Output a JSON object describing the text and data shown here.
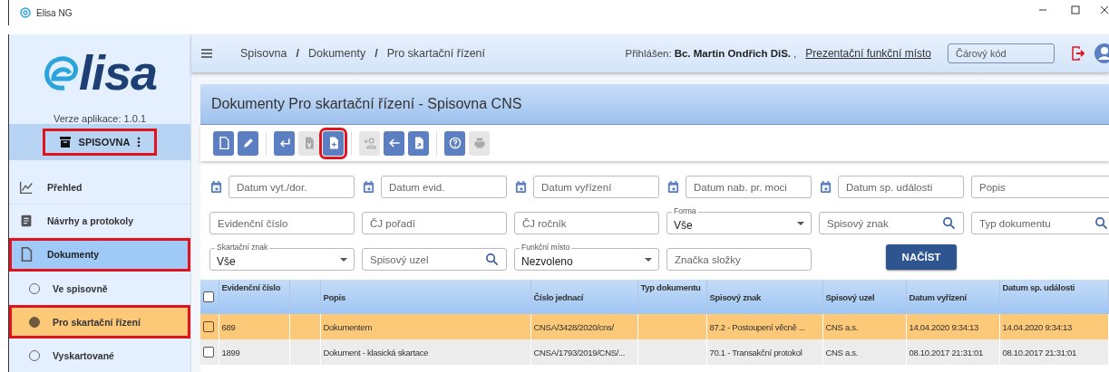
{
  "window": {
    "title": "Elisa NG"
  },
  "sidebar": {
    "logo": "lisa",
    "version": "Verze aplikace: 1.0.1",
    "section": {
      "label": "SPISOVNA",
      "highlighted": true
    },
    "items": [
      {
        "label": "Přehled",
        "selected": false,
        "highlighted": false
      },
      {
        "label": "Návrhy a protokoly",
        "selected": false,
        "highlighted": false
      },
      {
        "label": "Dokumenty",
        "selected": true,
        "highlighted": true,
        "children": [
          {
            "label": "Ve spisovně",
            "selected": false,
            "highlighted": false
          },
          {
            "label": "Pro skartační řízení",
            "selected": true,
            "highlighted": true
          },
          {
            "label": "Vyskartované",
            "selected": false,
            "highlighted": false
          }
        ]
      }
    ]
  },
  "header": {
    "breadcrumbs": [
      {
        "kind": "crumb",
        "label": "Spisovna"
      },
      {
        "kind": "separator",
        "label": "/"
      },
      {
        "kind": "crumb",
        "label": "Dokumenty"
      },
      {
        "kind": "separator",
        "label": "/"
      },
      {
        "kind": "crumb",
        "label": "Pro skartační řízení"
      }
    ],
    "login_label": "Přihlášen:",
    "user": "Bc. Martin Ondřich DiS.",
    "separator": ",",
    "workplace": "Prezentační funkční místo",
    "barcode": {
      "placeholder": "Čárový kód"
    }
  },
  "panel": {
    "title": "Dokumenty Pro skartační řízení - Spisovna CNS",
    "toolbar": [
      [
        {
          "disabled": false,
          "highlighted": false
        },
        {
          "disabled": false,
          "highlighted": false
        }
      ],
      [
        {
          "disabled": false,
          "highlighted": false
        },
        {
          "disabled": true,
          "highlighted": false
        },
        {
          "disabled": false,
          "highlighted": true
        }
      ],
      [
        {
          "disabled": true,
          "highlighted": false
        },
        {
          "disabled": false,
          "highlighted": false
        },
        {
          "disabled": false,
          "highlighted": false
        }
      ],
      [
        {
          "disabled": false,
          "highlighted": false
        },
        {
          "disabled": true,
          "highlighted": false
        }
      ]
    ],
    "filters": [
      [
        {
          "kind": "date",
          "placeholder": "Datum vyt./dor."
        },
        {
          "kind": "date",
          "placeholder": "Datum evid."
        },
        {
          "kind": "date",
          "placeholder": "Datum vyřízení"
        },
        {
          "kind": "date",
          "placeholder": "Datum nab. pr. moci"
        },
        {
          "kind": "date",
          "placeholder": "Datum sp. události"
        },
        {
          "kind": "text",
          "placeholder": "Popis"
        }
      ],
      [
        {
          "kind": "text",
          "placeholder": "Evidenční číslo"
        },
        {
          "kind": "text",
          "placeholder": "ČJ pořadí"
        },
        {
          "kind": "text",
          "placeholder": "ČJ ročník"
        },
        {
          "kind": "select",
          "label": "Forma",
          "value": "Vše"
        },
        {
          "kind": "search",
          "placeholder": "Spisový znak"
        },
        {
          "kind": "search",
          "placeholder": "Typ dokumentu"
        }
      ],
      [
        {
          "kind": "select",
          "label": "Skartační znak",
          "value": "Vše"
        },
        {
          "kind": "search",
          "placeholder": "Spisový uzel"
        },
        {
          "kind": "select",
          "label": "Funkční místo",
          "value": "Nezvoleno"
        },
        {
          "kind": "text",
          "placeholder": "Značka složky"
        },
        {
          "kind": "button",
          "label": "NAČÍST"
        }
      ]
    ],
    "table": {
      "all_checked": false,
      "columns": [
        "Evidenční číslo",
        "",
        "Popis",
        "Číslo jednací",
        "Typ dokumentu",
        "Spisový znak",
        "Spisový uzel",
        "Datum vyřízení",
        "Datum sp. události"
      ],
      "rows": [
        {
          "selected": true,
          "checked": false,
          "cells": [
            "689",
            "",
            "Dokumentem",
            "CNSA/3428/2020/cns/",
            "",
            "87.2 - Postoupení věcně ...",
            "CNS a.s.",
            "14.04.2020 9:34:13",
            "14.04.2020 9:34:13"
          ]
        },
        {
          "selected": false,
          "checked": false,
          "cells": [
            "1899",
            "",
            "Dokument - klasická skartace",
            "CNSA/1793/2019/CNS/...",
            "",
            "70.1 - Transakční protokol",
            "CNS a.s.",
            "08.10.2017 21:31:01",
            "08.10.2017 21:31:01"
          ]
        }
      ]
    }
  }
}
